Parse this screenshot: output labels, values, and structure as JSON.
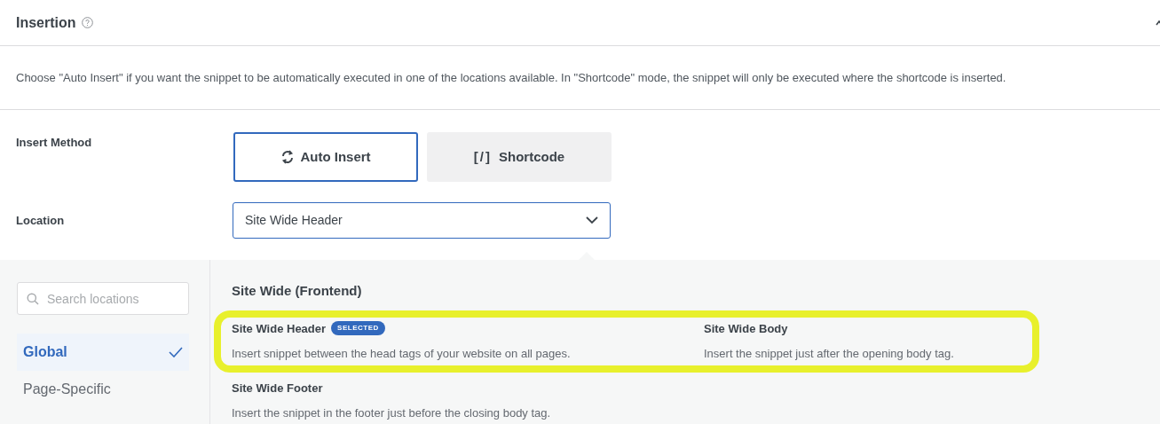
{
  "panel": {
    "title": "Insertion",
    "expanded": true
  },
  "description": "Choose \"Auto Insert\" if you want the snippet to be automatically executed in one of the locations available. In \"Shortcode\" mode, the snippet will only be executed where the shortcode is inserted.",
  "insert_method": {
    "label": "Insert Method",
    "options": [
      {
        "kind": "auto",
        "label": "Auto Insert",
        "selected": true
      },
      {
        "kind": "shortcode",
        "icon_text": "[/]",
        "label": "Shortcode",
        "selected": false
      }
    ]
  },
  "location": {
    "label": "Location",
    "value": "Site Wide Header"
  },
  "dropdown": {
    "search": {
      "placeholder": "Search locations"
    },
    "categories": [
      {
        "label": "Global",
        "selected": true
      },
      {
        "label": "Page-Specific",
        "selected": false
      }
    ],
    "section_title": "Site Wide (Frontend)",
    "rows": [
      {
        "highlighted": true,
        "items": [
          {
            "title": "Site Wide Header",
            "badge": "SELECTED",
            "description": "Insert snippet between the head tags of your website on all pages."
          },
          {
            "title": "Site Wide Body",
            "description": "Insert the snippet just after the opening body tag."
          }
        ]
      },
      {
        "highlighted": false,
        "items": [
          {
            "title": "Site Wide Footer",
            "description": "Insert the snippet in the footer just before the closing body tag."
          }
        ]
      }
    ]
  }
}
